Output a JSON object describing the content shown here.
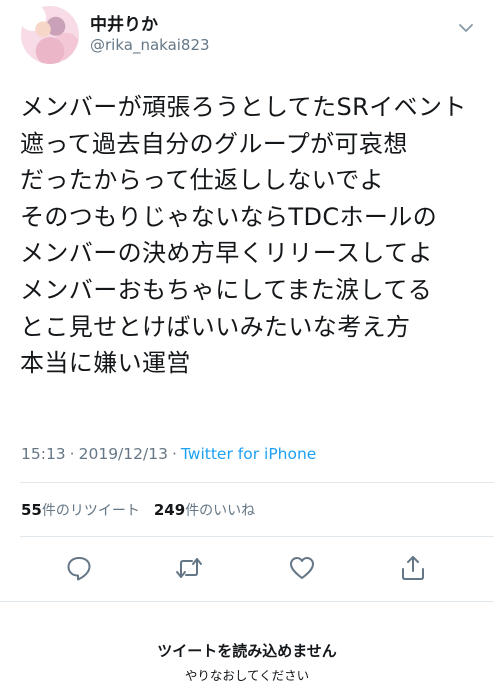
{
  "user": {
    "display_name": "中井りか",
    "username": "@rika_nakai823"
  },
  "tweet": {
    "lines": [
      "メンバーが頑張ろうとしてたSRイベント",
      "遮って過去自分のグループが可哀想",
      "だったからって仕返ししないでよ",
      "そのつもりじゃないならTDCホールの",
      "メンバーの決め方早くリリースしてよ",
      "メンバーおもちゃにしてまた涙してる",
      "とこ見せとけばいいみたいな考え方",
      "本当に嫌い運営"
    ],
    "time": "15:13",
    "separator": "·",
    "date": "2019/12/13",
    "source": "Twitter for iPhone"
  },
  "stats": {
    "retweets_count": "55",
    "retweets_label": "件のリツイート",
    "likes_count": "249",
    "likes_label": "件のいいね"
  },
  "actions": {
    "reply_icon": "reply-icon",
    "retweet_icon": "retweet-icon",
    "like_icon": "heart-icon",
    "share_icon": "share-icon"
  },
  "error": {
    "title": "ツイートを読み込めません",
    "subtitle": "やりなおしてください"
  },
  "colors": {
    "link": "#1da1f2",
    "secondary_text": "#657786",
    "icon": "#657786",
    "divider": "#e1e8ed"
  }
}
